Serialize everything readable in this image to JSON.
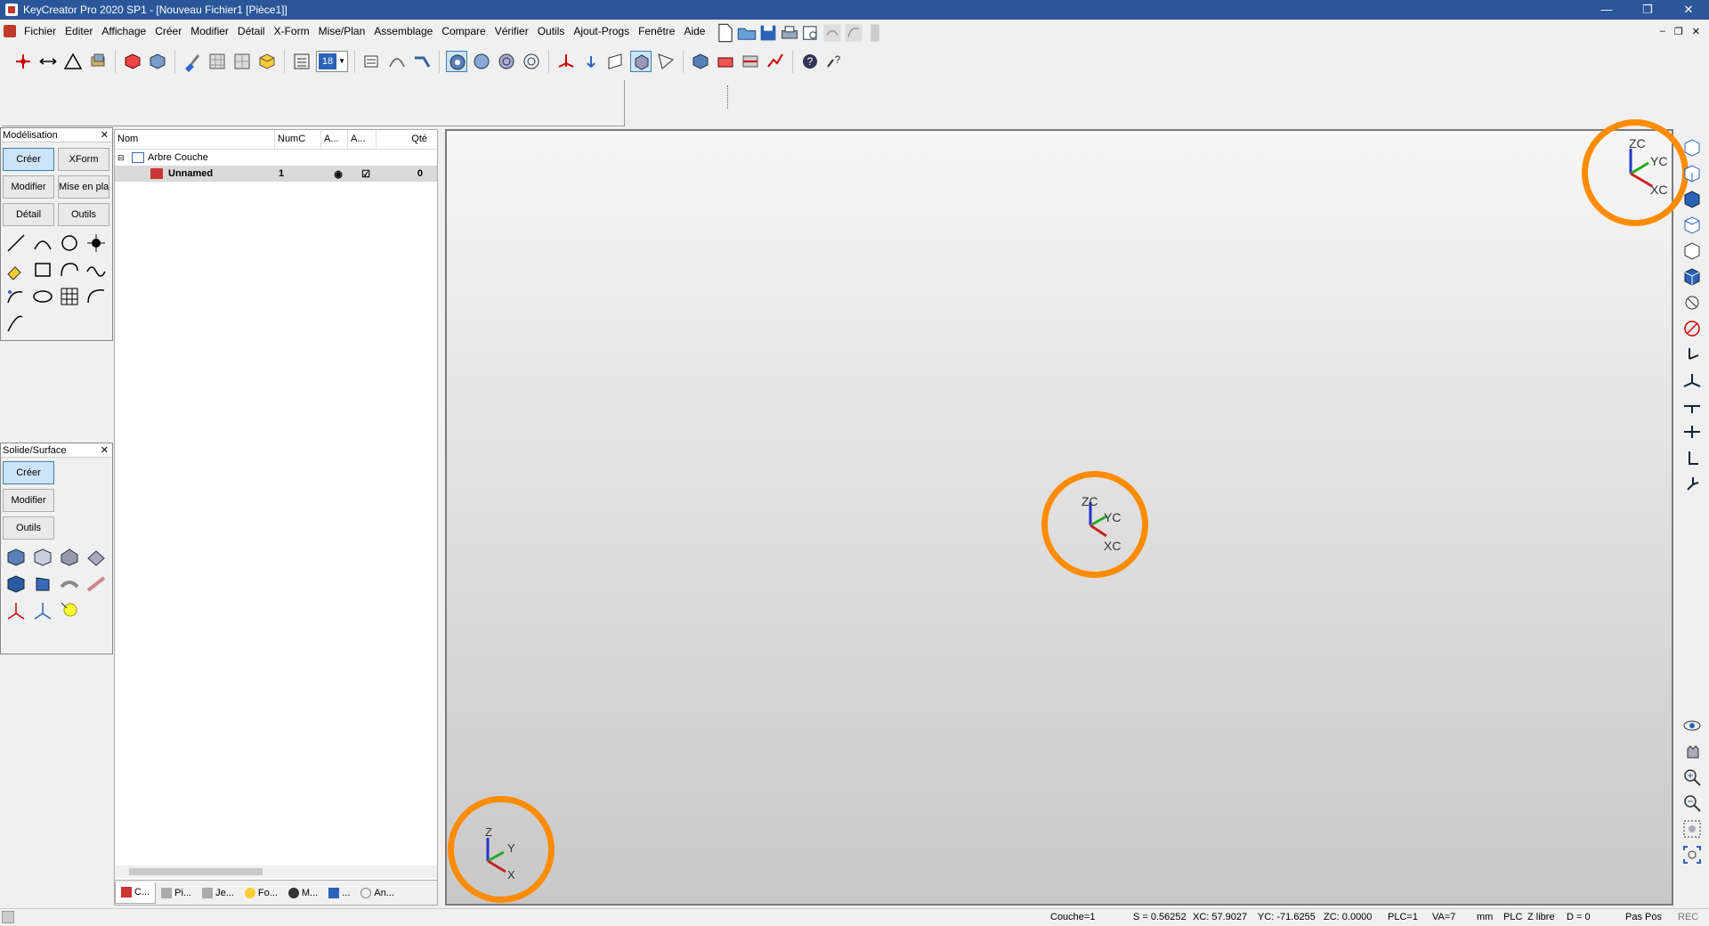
{
  "window": {
    "title": "KeyCreator Pro 2020 SP1 - [Nouveau Fichier1 [Pièce1]]"
  },
  "menu": [
    {
      "label": "Fichier"
    },
    {
      "label": "Editer"
    },
    {
      "label": "Affichage"
    },
    {
      "label": "Créer"
    },
    {
      "label": "Modifier"
    },
    {
      "label": "Détail"
    },
    {
      "label": "X-Form"
    },
    {
      "label": "Mise/Plan"
    },
    {
      "label": "Assemblage"
    },
    {
      "label": "Compare"
    },
    {
      "label": "Vérifier"
    },
    {
      "label": "Outils"
    },
    {
      "label": "Ajout-Progs"
    },
    {
      "label": "Fenêtre"
    },
    {
      "label": "Aide"
    }
  ],
  "toolbar": {
    "layer_value": "18"
  },
  "modelisation": {
    "title": "Modélisation",
    "buttons": [
      "Créer",
      "XForm",
      "Modifier",
      "Mise en plan",
      "Détail",
      "Outils"
    ]
  },
  "solide": {
    "title": "Solide/Surface",
    "buttons": [
      "Créer",
      "Modifier",
      "Outils"
    ]
  },
  "tree": {
    "columns": [
      "Nom",
      "NumC",
      "A...",
      "A...",
      "Qté"
    ],
    "root": "Arbre Couche",
    "row": {
      "name": "Unnamed",
      "num": "1",
      "qty": "0"
    },
    "tabs": [
      "C...",
      "Pi...",
      "Je...",
      "Fo...",
      "M...",
      "...",
      "An..."
    ]
  },
  "triads": {
    "top_right": {
      "z": "ZC",
      "y": "YC",
      "x": "XC"
    },
    "center": {
      "z": "ZC",
      "y": "YC",
      "x": "XC"
    },
    "bottom_left": {
      "z": "Z",
      "y": "Y",
      "x": "X"
    }
  },
  "status": {
    "couche": "Couche=1",
    "s": "S = 0.56252",
    "xc": "XC: 57.9027",
    "yc": "YC: -71.6255",
    "zc": "ZC: 0.0000",
    "plc": "PLC=1",
    "va": "VA=7",
    "mm": "mm",
    "plc2": "PLC",
    "zlibre": "Z libre",
    "d": "D = 0",
    "paspos": "Pas Pos",
    "rec": "REC"
  },
  "colors": {
    "title_bar": "#2b579a",
    "accent_orange": "#ff8c00",
    "active_button": "#cce4f7"
  },
  "window_buttons": [
    "—",
    "❐",
    "✕"
  ],
  "mdi_buttons": [
    "–",
    "❐",
    "✕"
  ]
}
